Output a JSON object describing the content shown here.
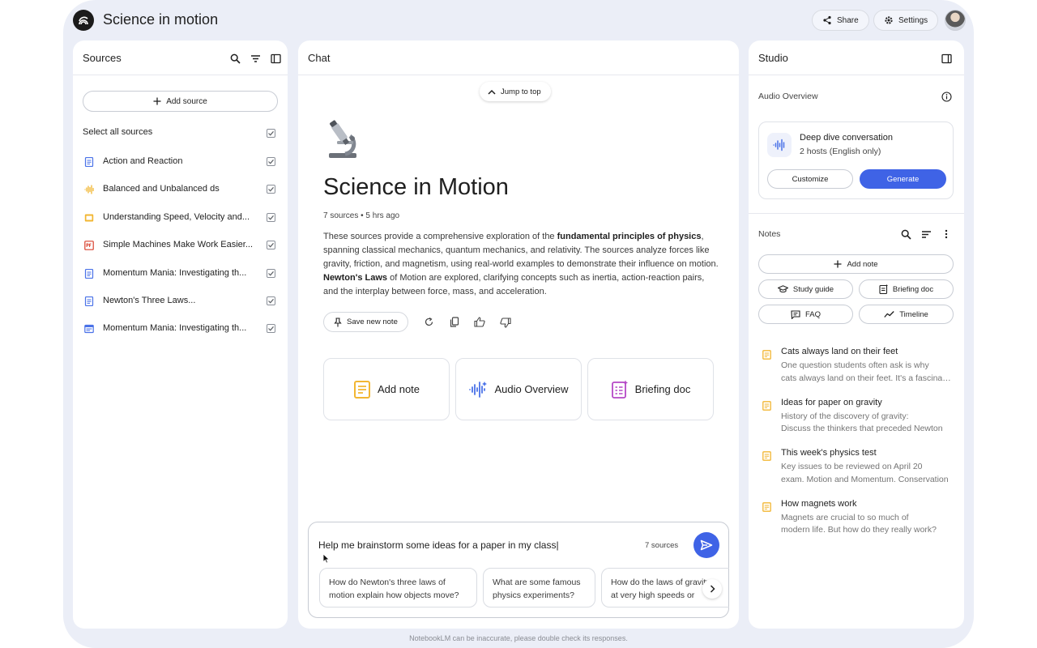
{
  "app": {
    "title": "Science in motion",
    "share_label": "Share",
    "settings_label": "Settings",
    "disclaimer": "NotebookLM can be inaccurate, please double check its responses."
  },
  "sources": {
    "title": "Sources",
    "add_label": "Add source",
    "select_all_label": "Select all sources",
    "items": [
      {
        "label": "Action and Reaction",
        "icon": "doc-icon",
        "color": "#4a72e8"
      },
      {
        "label": "Balanced and Unbalanced ds",
        "icon": "audio-icon",
        "color": "#f2b632"
      },
      {
        "label": "Understanding Speed, Velocity and...",
        "icon": "slides-icon",
        "color": "#f2b632"
      },
      {
        "label": "Simple Machines Make Work Easier...",
        "icon": "pdf-icon",
        "color": "#d9412e"
      },
      {
        "label": "Momentum Mania: Investigating th...",
        "icon": "doc-icon",
        "color": "#4a72e8"
      },
      {
        "label": "Newton's Three Laws...",
        "icon": "doc-icon",
        "color": "#4a72e8"
      },
      {
        "label": "Momentum Mania: Investigating th...",
        "icon": "web-icon",
        "color": "#4a72e8"
      }
    ]
  },
  "chat": {
    "title": "Chat",
    "jump_label": "Jump to top",
    "doc_title": "Science in Motion",
    "meta": "7 sources • 5 hrs ago",
    "summary": {
      "p1": "These sources provide a comprehensive exploration of the ",
      "b1": "fundamental principles of physics",
      "p2": ", spanning classical mechanics, quantum mechanics, and relativity. The sources analyze forces like gravity, friction, and magnetism, using real-world examples to demonstrate their influence on motion. ",
      "b2": "Newton's Laws",
      "p3": " of Motion are explored, clarifying concepts such as inertia, action-reaction pairs, and the interplay between force, mass, and acceleration."
    },
    "save_note_label": "Save new note",
    "cards": [
      {
        "label": "Add note"
      },
      {
        "label": "Audio Overview"
      },
      {
        "label": "Briefing doc"
      }
    ],
    "input_value": "Help me brainstorm some ideas for a paper in my class|",
    "source_count": "7 sources",
    "suggestions": [
      {
        "line1": "How do Newton's three laws of",
        "line2": "motion explain how objects move?"
      },
      {
        "line1": "What are some famous",
        "line2": "physics experiments?"
      },
      {
        "line1": "How do the laws of gravity",
        "line2": "at very high speeds or"
      }
    ]
  },
  "studio": {
    "title": "Studio",
    "audio_overview_label": "Audio Overview",
    "ao_title": "Deep dive conversation",
    "ao_sub": "2 hosts (English only)",
    "customize_label": "Customize",
    "generate_label": "Generate",
    "notes_label": "Notes",
    "add_note_label": "Add note",
    "chips": [
      "Study guide",
      "Briefing doc",
      "FAQ",
      "Timeline"
    ],
    "notes": [
      {
        "title": "Cats always land on their feet",
        "line1": "One question students often ask is why",
        "line2": "cats always land on their feet. It's a fascinating"
      },
      {
        "title": "Ideas for paper on gravity",
        "line1": "History of the discovery of gravity:",
        "line2": "Discuss the thinkers that preceded Newton"
      },
      {
        "title": "This week's physics test",
        "line1": "Key issues to be reviewed on April 20",
        "line2": "exam. Motion and Momentum. Conservation"
      },
      {
        "title": "How magnets work",
        "line1": "Magnets are crucial to so much of",
        "line2": "modern life. But how do they really work?"
      }
    ]
  },
  "colors": {
    "accent": "#3f63e6",
    "frame_bg": "#ebeef7",
    "note_yellow": "#f2b632"
  }
}
